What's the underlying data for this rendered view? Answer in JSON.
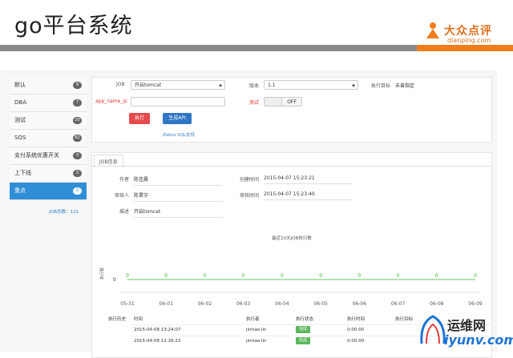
{
  "slide": {
    "title": "go平台系统",
    "logo_cn": "大众点评",
    "logo_en": "dianping.com",
    "colors": {
      "gray_bar": "#8a8a8a",
      "orange_bar": "#f07e1e",
      "accent_blue": "#2f8fd6"
    }
  },
  "sidebar": {
    "items": [
      {
        "label": "默认",
        "badge": "9"
      },
      {
        "label": "DBA",
        "badge": "7"
      },
      {
        "label": "测试",
        "badge": "20"
      },
      {
        "label": "SOS",
        "badge": "82"
      },
      {
        "label": "支付系统优惠开关",
        "badge": "3"
      },
      {
        "label": "上下线",
        "badge": "3"
      },
      {
        "label": "重点",
        "badge": "0",
        "active": true
      }
    ],
    "job_count": "JOB总数：122"
  },
  "form": {
    "job_label": "JOB",
    "job_value": "开启tomcat",
    "version_label": "版本",
    "version_value": "1.1",
    "target_label": "执行目标",
    "target_value": "未曾指定",
    "param_label": "app_name_ip",
    "test_label": "测试",
    "toggle_value": "OFF",
    "execute_button": "执行",
    "api_button": "生成API",
    "zebra_link": "Zebra SQL支持"
  },
  "detail": {
    "tab_label": "JOB信息",
    "author_label": "作者",
    "author_value": "陈佳晨",
    "created_label": "创建时间",
    "created_value": "2015-04-07 15:23:21",
    "reviewer_label": "审核人",
    "reviewer_value": "陈晋宇",
    "reviewed_label": "审核时间",
    "reviewed_value": "2015-04-07 15:23:40",
    "desc_label": "描述",
    "desc_value": "开启tomcat"
  },
  "chart_data": {
    "type": "line",
    "title": "最近10天JOB执行数",
    "ylabel": "执行数",
    "y_tick": "0",
    "categories": [
      "05-31",
      "06-01",
      "06-02",
      "06-03",
      "06-04",
      "06-05",
      "06-06",
      "06-07",
      "06-08",
      "06-09"
    ],
    "series": [
      {
        "values": [
          0,
          0,
          0,
          0,
          0,
          0,
          0,
          0,
          0,
          0
        ]
      }
    ],
    "line_color": "#2bb52b"
  },
  "history": {
    "label": "执行历史",
    "headers": [
      "时间",
      "执行者",
      "执行状态",
      "执行时间",
      "执行目标"
    ],
    "rows": [
      {
        "time": "2015-04-08 13:24:07",
        "user": "jimtao.lin",
        "status": "完成",
        "duration": "0:00:00",
        "target": ""
      },
      {
        "time": "2015-04-08 12:26:23",
        "user": "jimtao.lin",
        "status": "完成",
        "duration": "0:00:00",
        "target": ""
      }
    ]
  },
  "watermark": {
    "line1": "运维网",
    "line2": "iyunv.com"
  }
}
